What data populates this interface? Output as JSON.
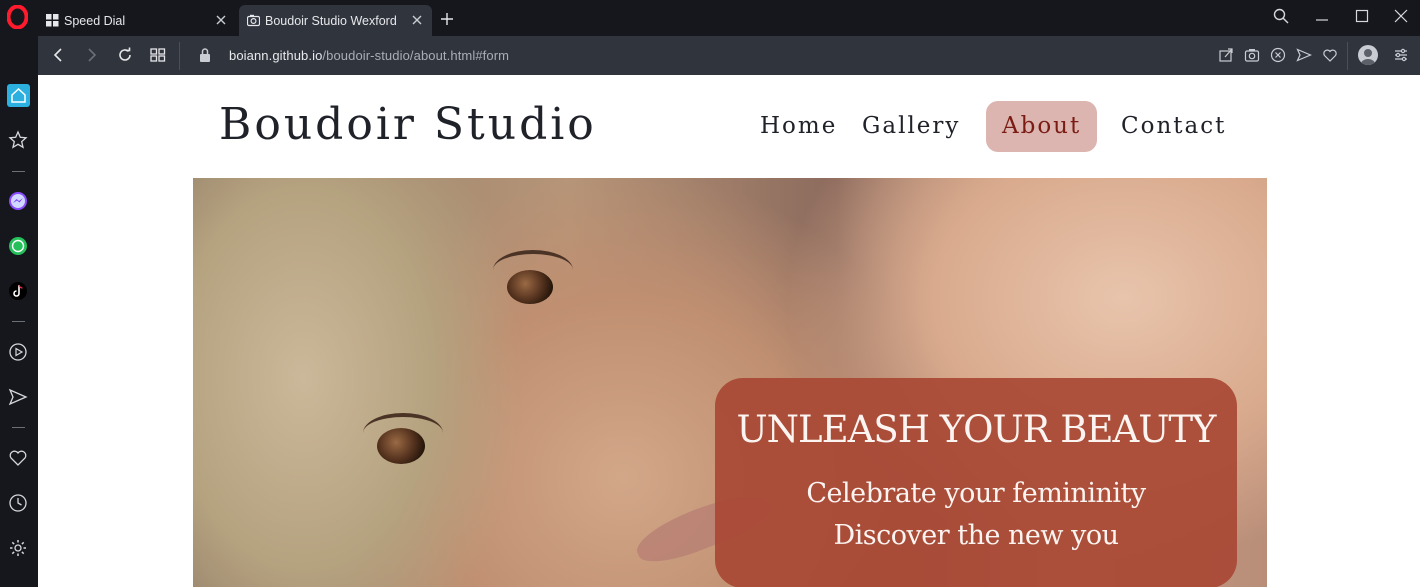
{
  "browser": {
    "tabs": [
      {
        "title": "Speed Dial",
        "active": false
      },
      {
        "title": "Boudoir Studio Wexford",
        "active": true
      }
    ],
    "url": {
      "host": "boiann.github.io",
      "path": "/boudoir-studio/about.html#form"
    },
    "sidebar_icons": [
      "home-icon",
      "star-icon",
      "messenger-icon",
      "whatsapp-icon",
      "tiktok-icon",
      "player-icon",
      "send-icon",
      "heart-icon",
      "history-icon",
      "settings-icon"
    ],
    "accent": "#2bb0e0"
  },
  "site": {
    "brand": "Boudoir Studio",
    "nav": [
      {
        "label": "Home",
        "active": false
      },
      {
        "label": "Gallery",
        "active": false
      },
      {
        "label": "About",
        "active": true
      },
      {
        "label": "Contact",
        "active": false
      }
    ],
    "hero": {
      "title": "UNLEASH YOUR BEAUTY",
      "line1": "Celebrate your femininity",
      "line2": "Discover the new you"
    },
    "colors": {
      "nav_active_bg": "#dcb5b0",
      "nav_active_text": "#7a1c14",
      "banner_bg": "#a84834"
    }
  }
}
